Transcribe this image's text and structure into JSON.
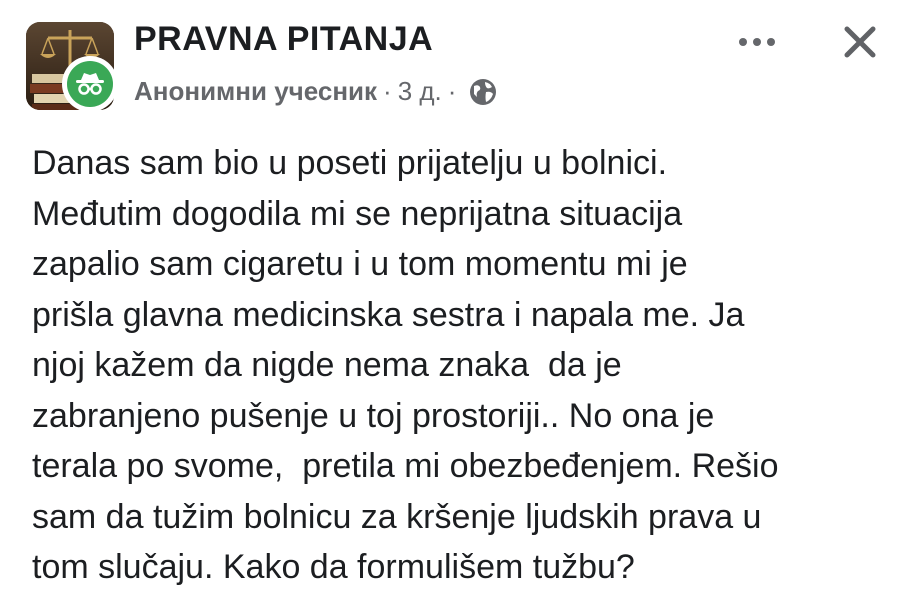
{
  "group": {
    "name": "PRAVNA PITANJA",
    "avatar_icon": "scales-of-justice-books-image"
  },
  "author_badge": {
    "icon": "anonymous-spy-icon",
    "color": "#3aa856"
  },
  "meta": {
    "author": "Анонимни учесник",
    "separator": "·",
    "time": "3 д.",
    "separator2": "·",
    "audience_icon": "globe-icon"
  },
  "actions": {
    "more_icon": "more-options-icon",
    "close_icon": "close-icon"
  },
  "post": {
    "lines": [
      "Danas sam bio u poseti prijatelju u bolnici.",
      "Međutim dogodila mi se neprijatna situacija",
      "zapalio sam cigaretu i u tom momentu mi je",
      "prišla glavna medicinska sestra i napala me. Ja",
      "njoj kažem da nigde nema znaka  da je",
      "zabranjeno pušenje u toj prostoriji.. No ona je",
      "terala po svome,  pretila mi obezbeđenjem. Rešio",
      "sam da tužim bolnicu za kršenje ljudskih prava u",
      "tom slučaju. Kako da formulišem tužbu?"
    ]
  }
}
